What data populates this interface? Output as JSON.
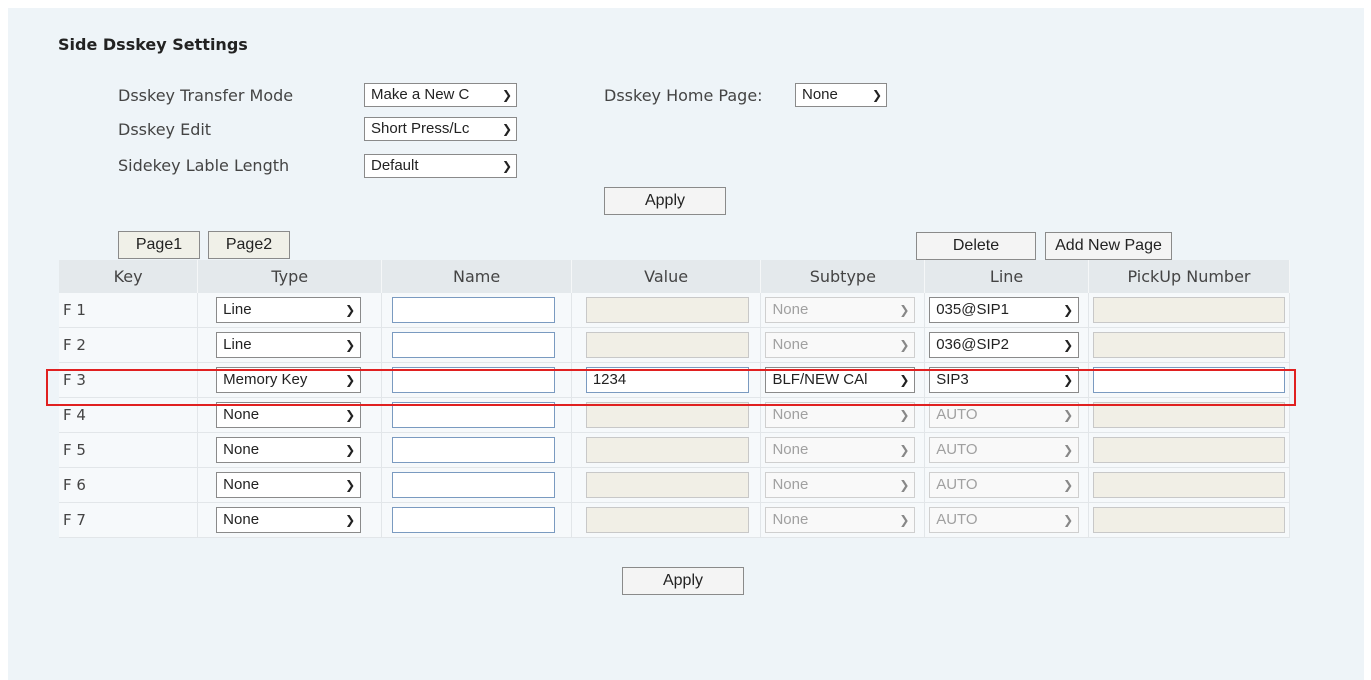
{
  "section_title": "Side Dsskey Settings",
  "settings": {
    "transfer_mode": {
      "label": "Dsskey Transfer Mode",
      "value": "Make a New C"
    },
    "dsskey_edit": {
      "label": "Dsskey Edit",
      "value": "Short Press/Lc"
    },
    "label_length": {
      "label": "Sidekey Lable Length",
      "value": "Default"
    },
    "home_page": {
      "label": "Dsskey Home Page:",
      "value": "None"
    }
  },
  "apply_label": "Apply",
  "tabs": [
    "Page1",
    "Page2"
  ],
  "delete_label": "Delete",
  "add_page_label": "Add New Page",
  "columns": [
    "Key",
    "Type",
    "Name",
    "Value",
    "Subtype",
    "Line",
    "PickUp Number"
  ],
  "rows": [
    {
      "key": "F 1",
      "type": "Line",
      "name": "",
      "value": "",
      "subtype": "None",
      "subtype_enabled": false,
      "line": "035@SIP1",
      "line_enabled": true,
      "pickup": "",
      "value_enabled": false,
      "pickup_enabled": false
    },
    {
      "key": "F 2",
      "type": "Line",
      "name": "",
      "value": "",
      "subtype": "None",
      "subtype_enabled": false,
      "line": "036@SIP2",
      "line_enabled": true,
      "pickup": "",
      "value_enabled": false,
      "pickup_enabled": false
    },
    {
      "key": "F 3",
      "type": "Memory Key",
      "name": "",
      "value": "1234",
      "subtype": "BLF/NEW CAl",
      "subtype_enabled": true,
      "line": "SIP3",
      "line_enabled": true,
      "pickup": "",
      "value_enabled": true,
      "pickup_enabled": true
    },
    {
      "key": "F 4",
      "type": "None",
      "name": "",
      "value": "",
      "subtype": "None",
      "subtype_enabled": false,
      "line": "AUTO",
      "line_enabled": false,
      "pickup": "",
      "value_enabled": false,
      "pickup_enabled": false
    },
    {
      "key": "F 5",
      "type": "None",
      "name": "",
      "value": "",
      "subtype": "None",
      "subtype_enabled": false,
      "line": "AUTO",
      "line_enabled": false,
      "pickup": "",
      "value_enabled": false,
      "pickup_enabled": false
    },
    {
      "key": "F 6",
      "type": "None",
      "name": "",
      "value": "",
      "subtype": "None",
      "subtype_enabled": false,
      "line": "AUTO",
      "line_enabled": false,
      "pickup": "",
      "value_enabled": false,
      "pickup_enabled": false
    },
    {
      "key": "F 7",
      "type": "None",
      "name": "",
      "value": "",
      "subtype": "None",
      "subtype_enabled": false,
      "line": "AUTO",
      "line_enabled": false,
      "pickup": "",
      "value_enabled": false,
      "pickup_enabled": false
    }
  ],
  "highlight_color": "#e02020"
}
